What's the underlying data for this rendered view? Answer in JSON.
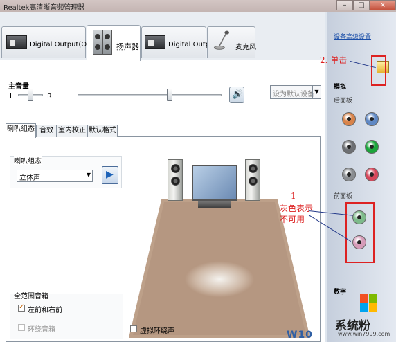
{
  "window": {
    "title": "Realtek高清晰音频管理器",
    "minimize": "–",
    "maximize": "□",
    "close": "×"
  },
  "device_tabs": [
    {
      "label": "Digital Output(Optical)"
    },
    {
      "label": "扬声器"
    },
    {
      "label": "Digital Output"
    },
    {
      "label": "麦克风"
    }
  ],
  "volume": {
    "label": "主音量",
    "left": "L",
    "right": "R",
    "default_device": "设为默认设备"
  },
  "sub_tabs": [
    "喇叭组态",
    "音效",
    "室内校正",
    "默认格式"
  ],
  "speaker_config": {
    "label": "喇叭组态",
    "selected": "立体声"
  },
  "full_range": {
    "title": "全范围音箱",
    "front": "左前和右前",
    "surround": "环绕音箱"
  },
  "virtual_surround": "虚拟环绕声",
  "side": {
    "advanced_link": "设备高级设置",
    "analog": "模拟",
    "back_panel": "后面板",
    "front_panel": "前面板",
    "digital": "数字"
  },
  "jack_colors": {
    "back": [
      "#d8834a",
      "#5f88c4",
      "#6d6f73",
      "#1ba53b",
      "#8a8d91",
      "#d6475a"
    ],
    "front": [
      "#7dba8a",
      "#d69bb8"
    ]
  },
  "annotations": {
    "click": "2. 单击",
    "num": "1",
    "gray_note_1": "灰色表示",
    "gray_note_2": "不可用"
  },
  "watermark": {
    "brand": "系统粉",
    "url": "www.win7999.com",
    "partial": "W10"
  }
}
